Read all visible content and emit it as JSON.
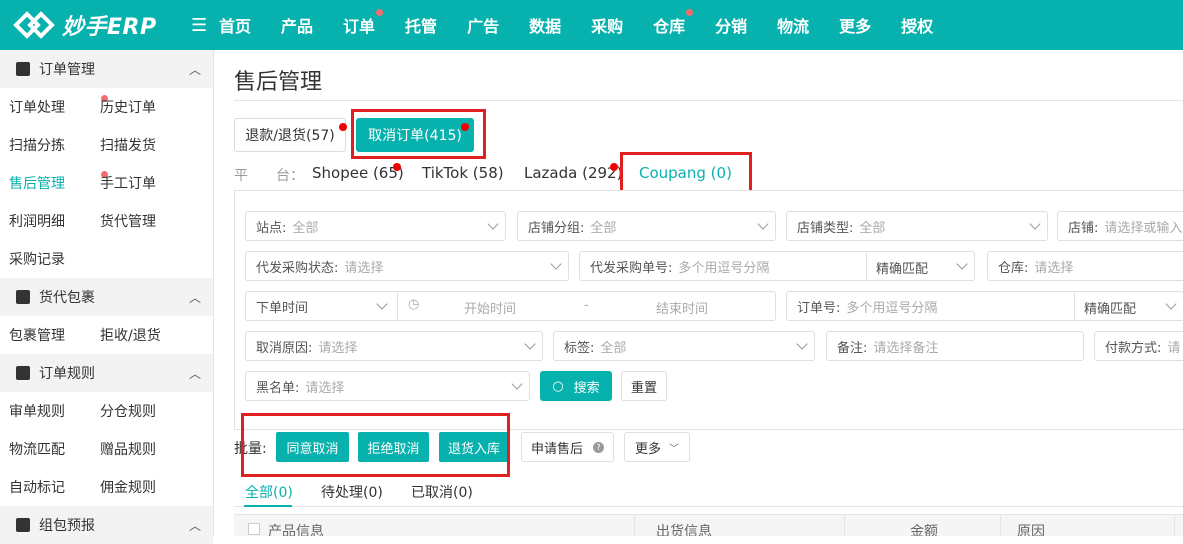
{
  "app": {
    "name": "妙手ERP"
  },
  "topnav": {
    "items": [
      {
        "label": "首页",
        "dot": false
      },
      {
        "label": "产品",
        "dot": false
      },
      {
        "label": "订单",
        "dot": true
      },
      {
        "label": "托管",
        "dot": false
      },
      {
        "label": "广告",
        "dot": false
      },
      {
        "label": "数据",
        "dot": false
      },
      {
        "label": "采购",
        "dot": false
      },
      {
        "label": "仓库",
        "dot": true
      },
      {
        "label": "分销",
        "dot": false
      },
      {
        "label": "物流",
        "dot": false
      },
      {
        "label": "更多",
        "dot": false
      },
      {
        "label": "授权",
        "dot": false
      }
    ]
  },
  "sidebar": {
    "sections": [
      {
        "title": "订单管理",
        "icon": "order-icon",
        "rows": [
          [
            "订单处理",
            "历史订单"
          ],
          [
            "扫描分拣",
            "扫描发货"
          ],
          [
            "售后管理",
            "手工订单"
          ],
          [
            "利润明细",
            "货代管理"
          ],
          [
            "采购记录",
            ""
          ]
        ]
      },
      {
        "title": "货代包裹",
        "icon": "package-icon",
        "rows": [
          [
            "包裹管理",
            "拒收/退货"
          ]
        ]
      },
      {
        "title": "订单规则",
        "icon": "rules-icon",
        "rows": [
          [
            "审单规则",
            "分仓规则"
          ],
          [
            "物流匹配",
            "赠品规则"
          ],
          [
            "自动标记",
            "佣金规则"
          ]
        ]
      },
      {
        "title": "组包预报",
        "icon": "bundle-icon",
        "rows": []
      }
    ]
  },
  "page": {
    "title": "售后管理"
  },
  "tabs": {
    "refund": "退款/退货(57)",
    "cancel": "取消订单(415)"
  },
  "platform": {
    "label": "平　　台：",
    "items": [
      "Shopee (65)",
      "TikTok (58)",
      "Lazada (292)",
      "Coupang (0)"
    ]
  },
  "filters": {
    "site": {
      "label": "站点:",
      "value": "全部"
    },
    "shop_group": {
      "label": "店铺分组:",
      "value": "全部"
    },
    "shop_type": {
      "label": "店铺类型:",
      "value": "全部"
    },
    "shop": {
      "label": "店铺:",
      "placeholder": "请选择或输入"
    },
    "purchase_status": {
      "label": "代发采购状态:",
      "placeholder": "请选择"
    },
    "purchase_no": {
      "label": "代发采购单号:",
      "placeholder": "多个用逗号分隔",
      "match": "精确匹配"
    },
    "warehouse": {
      "label": "仓库:",
      "placeholder": "请选择"
    },
    "order_time": {
      "label": "下单时间",
      "start": "开始时间",
      "dash": "-",
      "end": "结束时间"
    },
    "order_no": {
      "label": "订单号:",
      "placeholder": "多个用逗号分隔",
      "match": "精确匹配"
    },
    "cancel_reason": {
      "label": "取消原因:",
      "placeholder": "请选择"
    },
    "tag": {
      "label": "标签:",
      "value": "全部"
    },
    "remark": {
      "label": "备注:",
      "placeholder": "请选择备注"
    },
    "payment": {
      "label": "付款方式:",
      "placeholder": "请"
    },
    "blacklist": {
      "label": "黑名单:",
      "placeholder": "请选择"
    },
    "search": "搜索",
    "reset": "重置"
  },
  "batch": {
    "label": "批量:",
    "agree": "同意取消",
    "reject": "拒绝取消",
    "return_stock": "退货入库",
    "apply": "申请售后",
    "more": "更多"
  },
  "status_tabs": [
    "全部(0)",
    "待处理(0)",
    "已取消(0)"
  ],
  "table": {
    "headers": [
      "产品信息",
      "出货信息",
      "金额",
      "原因"
    ]
  },
  "colors": {
    "accent": "#07b1ad",
    "highlight": "#e02020",
    "dot": "#f56c6c"
  }
}
